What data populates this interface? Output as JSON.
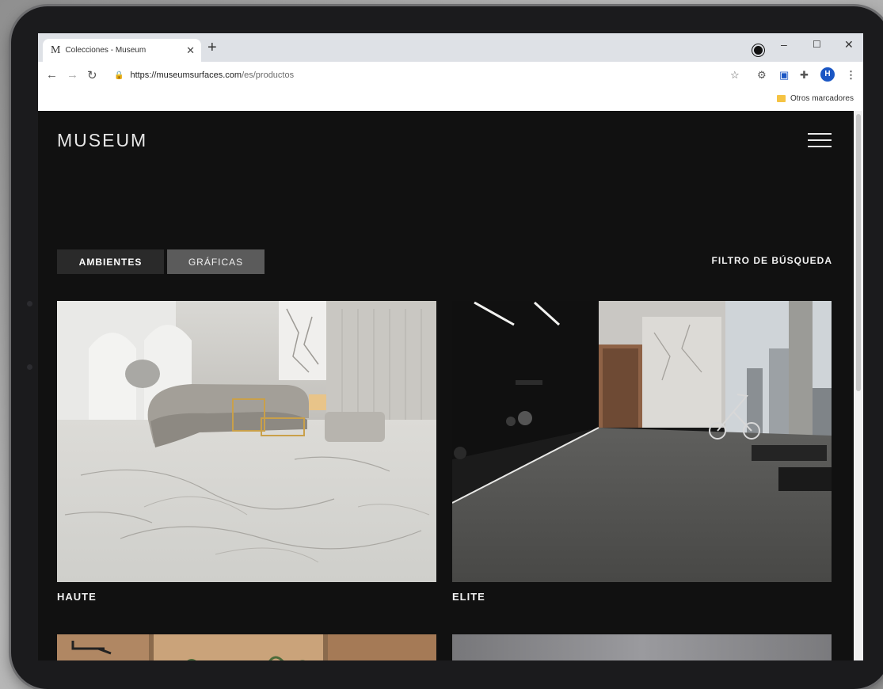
{
  "browser": {
    "tab_title": "Colecciones - Museum",
    "tab_favicon": "M",
    "new_tab": "+",
    "url_host": "https://museumsurfaces.com",
    "url_path": "/es/productos",
    "profile_initial": "H",
    "bookmark_folder": "Otros marcadores"
  },
  "site": {
    "logo": "MUSEUM",
    "tabs": [
      {
        "label": "AMBIENTES",
        "active": true
      },
      {
        "label": "GRÁFICAS",
        "active": false
      }
    ],
    "filter_label": "FILTRO DE BÚSQUEDA",
    "collections": [
      {
        "name": "HAUTE"
      },
      {
        "name": "ELITE"
      }
    ]
  },
  "colors": {
    "page_bg": "#111111",
    "tab_active": "#2a2a2a",
    "tab_inactive": "#5b5b5b",
    "profile": "#1a56c4"
  }
}
